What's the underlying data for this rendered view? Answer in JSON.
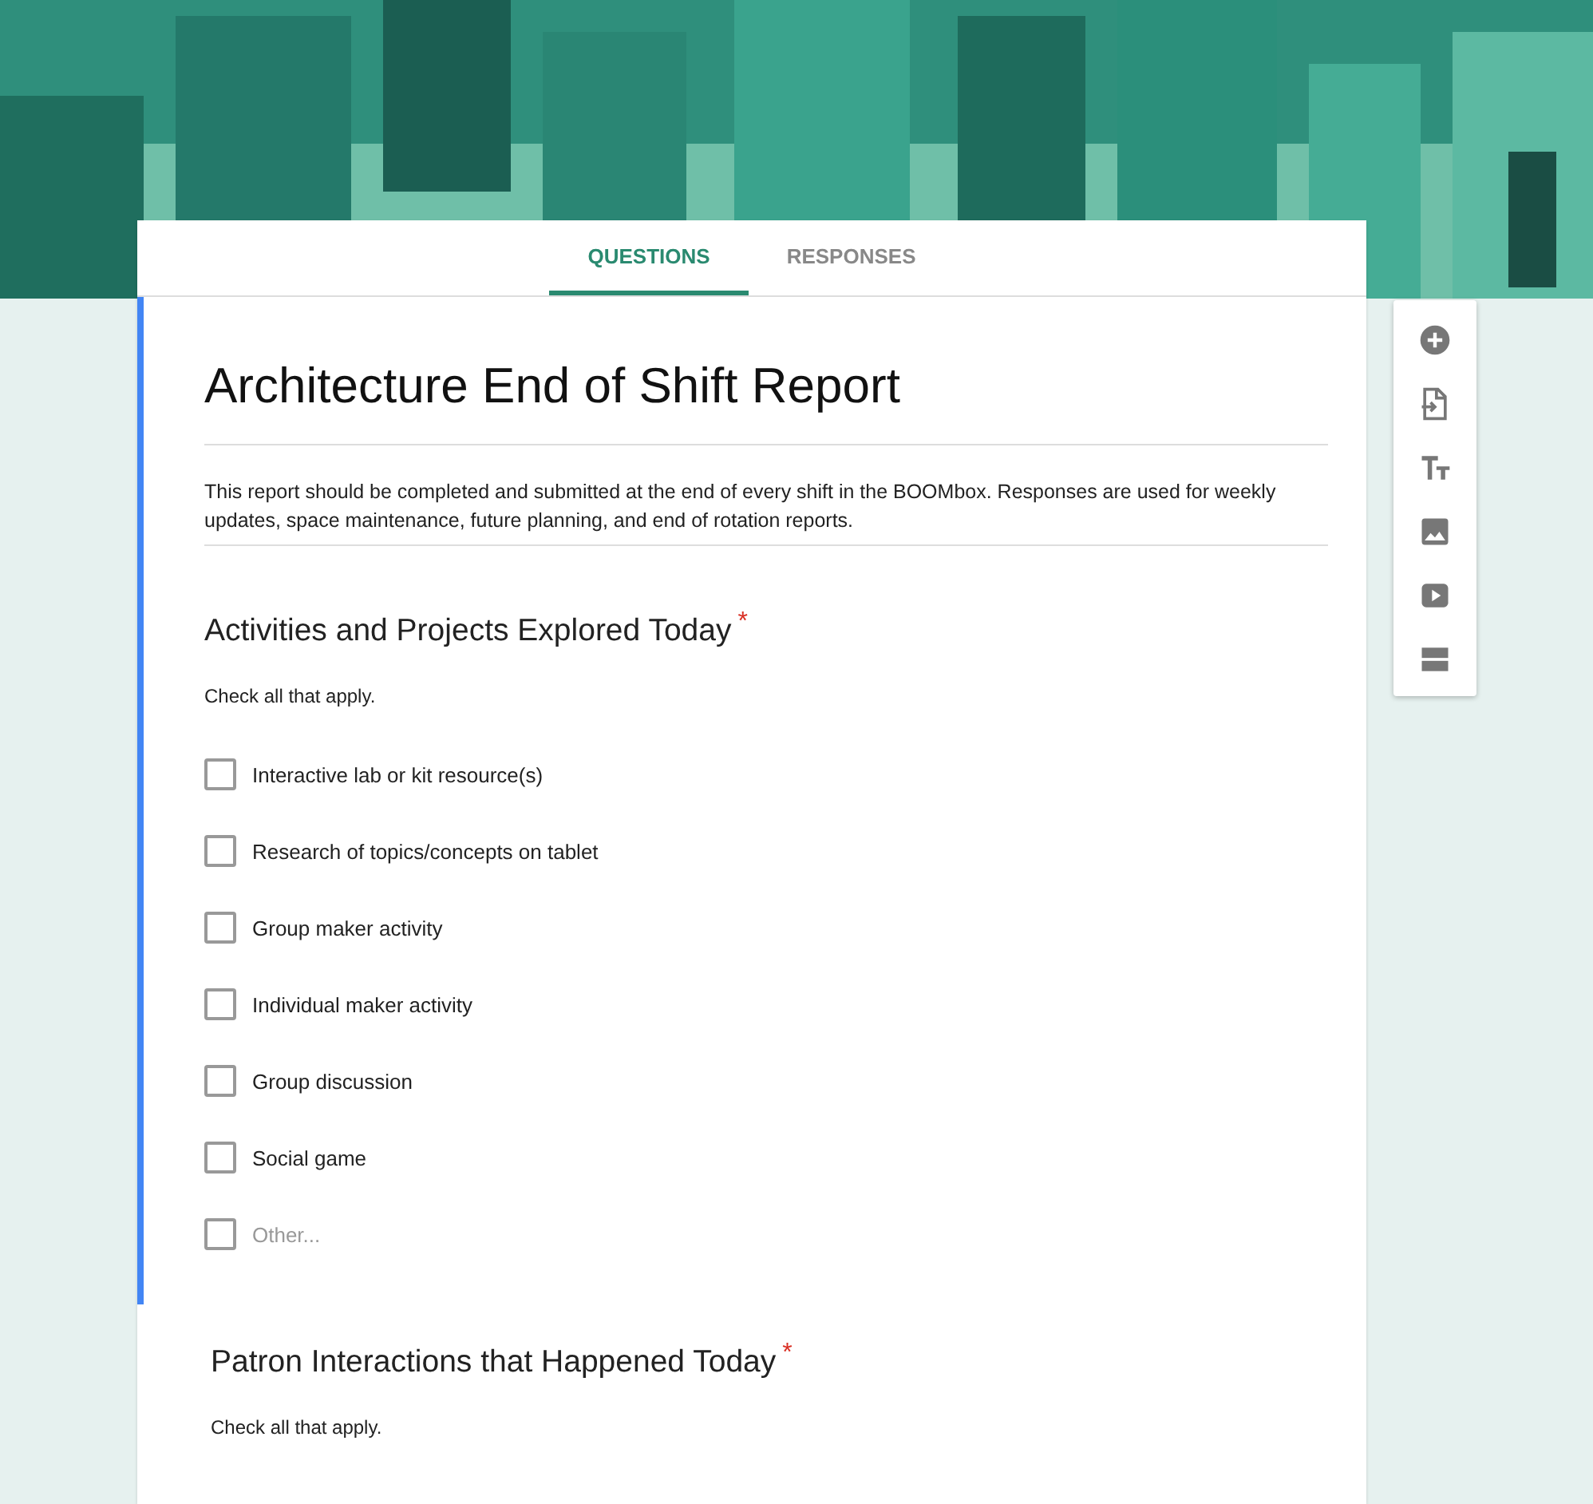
{
  "tabs": [
    {
      "label": "QUESTIONS",
      "selected": true
    },
    {
      "label": "RESPONSES",
      "selected": false
    }
  ],
  "form": {
    "title": "Architecture End of Shift Report",
    "description": "This report should be completed and submitted at the end of every shift in the BOOMbox. Responses are used for weekly updates, space maintenance, future planning, and end of rotation reports."
  },
  "questions": [
    {
      "title": "Activities and Projects Explored Today",
      "required": true,
      "focused": true,
      "hint": "Check all that apply.",
      "options": [
        {
          "label": "Interactive lab or kit resource(s)",
          "kind": "option",
          "checked": false
        },
        {
          "label": "Research of topics/concepts on tablet",
          "kind": "option",
          "checked": false
        },
        {
          "label": "Group maker activity",
          "kind": "option",
          "checked": false
        },
        {
          "label": "Individual maker activity",
          "kind": "option",
          "checked": false
        },
        {
          "label": "Group discussion",
          "kind": "option",
          "checked": false
        },
        {
          "label": "Social game",
          "kind": "option",
          "checked": false
        },
        {
          "label": "Other...",
          "kind": "other",
          "checked": false
        }
      ]
    },
    {
      "title": "Patron Interactions that Happened Today",
      "required": true,
      "focused": false,
      "hint": "Check all that apply."
    }
  ],
  "required_mark": "*"
}
